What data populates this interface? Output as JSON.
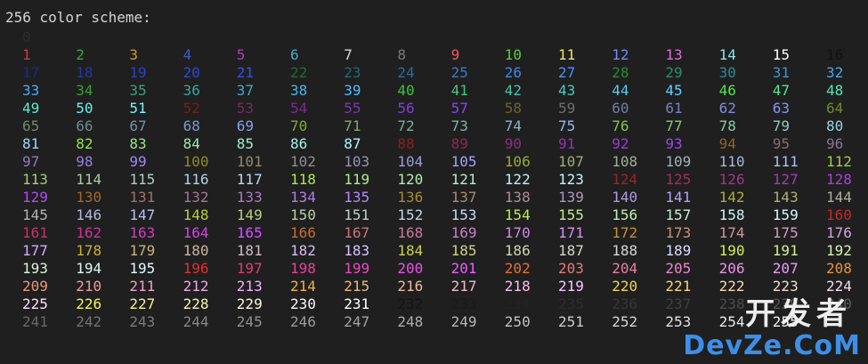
{
  "header": {
    "text": "256 color scheme:"
  },
  "rows": [
    {
      "cells": [
        {
          "n": "0",
          "c": "#2e2e2e"
        }
      ]
    },
    {
      "cells": [
        {
          "n": "1",
          "c": "#d13d3d"
        },
        {
          "n": "2",
          "c": "#3aa63a"
        },
        {
          "n": "3",
          "c": "#c89f2a"
        },
        {
          "n": "4",
          "c": "#3d5cc8"
        },
        {
          "n": "5",
          "c": "#a63fb8"
        },
        {
          "n": "6",
          "c": "#4aa8c8"
        },
        {
          "n": "7",
          "c": "#d8d8d8"
        },
        {
          "n": "8",
          "c": "#7a7a7a"
        },
        {
          "n": "9",
          "c": "#ee5c5c"
        },
        {
          "n": "10",
          "c": "#5ccc3c"
        },
        {
          "n": "11",
          "c": "#f0e06a"
        },
        {
          "n": "12",
          "c": "#6e8cf0"
        },
        {
          "n": "13",
          "c": "#e06ae0"
        },
        {
          "n": "14",
          "c": "#8ee6e6"
        },
        {
          "n": "15",
          "c": "#ffffff"
        },
        {
          "n": "16",
          "c": "#111111"
        }
      ]
    },
    {
      "cells": [
        {
          "n": "17",
          "c": "#1a2a8a"
        },
        {
          "n": "18",
          "c": "#2236a6"
        },
        {
          "n": "19",
          "c": "#2a42c4"
        },
        {
          "n": "20",
          "c": "#2e48dc"
        },
        {
          "n": "21",
          "c": "#3050f0"
        },
        {
          "n": "22",
          "c": "#1e6e2a"
        },
        {
          "n": "23",
          "c": "#1e6a70"
        },
        {
          "n": "24",
          "c": "#2e6a9a"
        },
        {
          "n": "25",
          "c": "#3a7ac8"
        },
        {
          "n": "26",
          "c": "#3e86e8"
        },
        {
          "n": "27",
          "c": "#4a90ff"
        },
        {
          "n": "28",
          "c": "#2a8a30"
        },
        {
          "n": "29",
          "c": "#2e8a6e"
        },
        {
          "n": "30",
          "c": "#2e8a9a"
        },
        {
          "n": "31",
          "c": "#3a9ac6"
        },
        {
          "n": "32",
          "c": "#4aa6ee"
        }
      ]
    },
    {
      "cells": [
        {
          "n": "33",
          "c": "#4aa8ff"
        },
        {
          "n": "34",
          "c": "#3a9e36"
        },
        {
          "n": "35",
          "c": "#3aa07a"
        },
        {
          "n": "36",
          "c": "#3aa29e"
        },
        {
          "n": "37",
          "c": "#44aac8"
        },
        {
          "n": "38",
          "c": "#4cb2ec"
        },
        {
          "n": "39",
          "c": "#52baff"
        },
        {
          "n": "40",
          "c": "#40c040"
        },
        {
          "n": "41",
          "c": "#48c482"
        },
        {
          "n": "42",
          "c": "#48c4a8"
        },
        {
          "n": "43",
          "c": "#4ec8c8"
        },
        {
          "n": "44",
          "c": "#56ccee"
        },
        {
          "n": "45",
          "c": "#5cd2ff"
        },
        {
          "n": "46",
          "c": "#4ee44e"
        },
        {
          "n": "47",
          "c": "#5ae48e"
        },
        {
          "n": "48",
          "c": "#5ae6b4"
        }
      ]
    },
    {
      "cells": [
        {
          "n": "49",
          "c": "#5ee8d4"
        },
        {
          "n": "50",
          "c": "#68eef2"
        },
        {
          "n": "51",
          "c": "#72f4ff"
        },
        {
          "n": "52",
          "c": "#7a1c1c"
        },
        {
          "n": "53",
          "c": "#7a2a5e"
        },
        {
          "n": "54",
          "c": "#7a2a8e"
        },
        {
          "n": "55",
          "c": "#7e34b4"
        },
        {
          "n": "56",
          "c": "#823ed8"
        },
        {
          "n": "57",
          "c": "#8844f4"
        },
        {
          "n": "58",
          "c": "#6e6424"
        },
        {
          "n": "59",
          "c": "#6e6e6e"
        },
        {
          "n": "60",
          "c": "#707ea0"
        },
        {
          "n": "61",
          "c": "#7682c0"
        },
        {
          "n": "62",
          "c": "#7c8ce0"
        },
        {
          "n": "63",
          "c": "#8494ff"
        },
        {
          "n": "64",
          "c": "#6e8a2a"
        }
      ]
    },
    {
      "cells": [
        {
          "n": "65",
          "c": "#6e8a6a"
        },
        {
          "n": "66",
          "c": "#6e8a8a"
        },
        {
          "n": "67",
          "c": "#7490ac"
        },
        {
          "n": "68",
          "c": "#7c98cc"
        },
        {
          "n": "69",
          "c": "#82a0ee"
        },
        {
          "n": "70",
          "c": "#7eaa34"
        },
        {
          "n": "71",
          "c": "#7eaa6e"
        },
        {
          "n": "72",
          "c": "#7eaa92"
        },
        {
          "n": "73",
          "c": "#84aeae"
        },
        {
          "n": "74",
          "c": "#8ab4d0"
        },
        {
          "n": "75",
          "c": "#90baf0"
        },
        {
          "n": "76",
          "c": "#84c840"
        },
        {
          "n": "77",
          "c": "#88c878"
        },
        {
          "n": "78",
          "c": "#8ccaa0"
        },
        {
          "n": "79",
          "c": "#90ccc0"
        },
        {
          "n": "80",
          "c": "#96d2e4"
        }
      ]
    },
    {
      "cells": [
        {
          "n": "81",
          "c": "#9cd8ff"
        },
        {
          "n": "82",
          "c": "#8ee84c"
        },
        {
          "n": "83",
          "c": "#94ea86"
        },
        {
          "n": "84",
          "c": "#98eaaa"
        },
        {
          "n": "85",
          "c": "#9eeccc"
        },
        {
          "n": "86",
          "c": "#a4f0ec"
        },
        {
          "n": "87",
          "c": "#acf6ff"
        },
        {
          "n": "88",
          "c": "#8a2020"
        },
        {
          "n": "89",
          "c": "#8a2a56"
        },
        {
          "n": "90",
          "c": "#8c2e86"
        },
        {
          "n": "91",
          "c": "#9034ac"
        },
        {
          "n": "92",
          "c": "#963cd0"
        },
        {
          "n": "93",
          "c": "#9c44f0"
        },
        {
          "n": "94",
          "c": "#8a6628"
        },
        {
          "n": "95",
          "c": "#8a6e6e"
        },
        {
          "n": "96",
          "c": "#8c7296"
        }
      ]
    },
    {
      "cells": [
        {
          "n": "97",
          "c": "#9078bc"
        },
        {
          "n": "98",
          "c": "#9680de"
        },
        {
          "n": "99",
          "c": "#9c88ff"
        },
        {
          "n": "100",
          "c": "#8e8a2c"
        },
        {
          "n": "101",
          "c": "#8e8a6e"
        },
        {
          "n": "102",
          "c": "#8e8e8e"
        },
        {
          "n": "103",
          "c": "#9296b6"
        },
        {
          "n": "104",
          "c": "#989cda"
        },
        {
          "n": "105",
          "c": "#9ea4fa"
        },
        {
          "n": "106",
          "c": "#98ac38"
        },
        {
          "n": "107",
          "c": "#9aae72"
        },
        {
          "n": "108",
          "c": "#9cae96"
        },
        {
          "n": "109",
          "c": "#a0b2b8"
        },
        {
          "n": "110",
          "c": "#a6b8da"
        },
        {
          "n": "111",
          "c": "#acbefa"
        },
        {
          "n": "112",
          "c": "#a2cc44"
        }
      ]
    },
    {
      "cells": [
        {
          "n": "113",
          "c": "#a6cc7e"
        },
        {
          "n": "114",
          "c": "#a8cca2"
        },
        {
          "n": "115",
          "c": "#accec4"
        },
        {
          "n": "116",
          "c": "#b0d2e6"
        },
        {
          "n": "117",
          "c": "#b6d8ff"
        },
        {
          "n": "118",
          "c": "#aaea50"
        },
        {
          "n": "119",
          "c": "#aeec8a"
        },
        {
          "n": "120",
          "c": "#b2ecae"
        },
        {
          "n": "121",
          "c": "#b6eed0"
        },
        {
          "n": "122",
          "c": "#baf2f0"
        },
        {
          "n": "123",
          "c": "#c0f6ff"
        },
        {
          "n": "124",
          "c": "#9e2424"
        },
        {
          "n": "125",
          "c": "#a02e5e"
        },
        {
          "n": "126",
          "c": "#a2348c"
        },
        {
          "n": "127",
          "c": "#a63ab4"
        },
        {
          "n": "128",
          "c": "#aa42d8"
        }
      ]
    },
    {
      "cells": [
        {
          "n": "129",
          "c": "#b04af8"
        },
        {
          "n": "130",
          "c": "#a0682c"
        },
        {
          "n": "131",
          "c": "#a27070"
        },
        {
          "n": "132",
          "c": "#a47498"
        },
        {
          "n": "133",
          "c": "#a87ac0"
        },
        {
          "n": "134",
          "c": "#ac82e2"
        },
        {
          "n": "135",
          "c": "#b28aff"
        },
        {
          "n": "136",
          "c": "#a48a34"
        },
        {
          "n": "137",
          "c": "#a68e72"
        },
        {
          "n": "138",
          "c": "#a89096"
        },
        {
          "n": "139",
          "c": "#ac96bc"
        },
        {
          "n": "140",
          "c": "#b09cde"
        },
        {
          "n": "141",
          "c": "#b6a2fc"
        },
        {
          "n": "142",
          "c": "#acac3c"
        },
        {
          "n": "143",
          "c": "#aeae76"
        },
        {
          "n": "144",
          "c": "#b0b09a"
        }
      ]
    },
    {
      "cells": [
        {
          "n": "145",
          "c": "#b2b2b2"
        },
        {
          "n": "146",
          "c": "#b6b8dc"
        },
        {
          "n": "147",
          "c": "#bcbeff"
        },
        {
          "n": "148",
          "c": "#b6ce48"
        },
        {
          "n": "149",
          "c": "#b8ce82"
        },
        {
          "n": "150",
          "c": "#bacea6"
        },
        {
          "n": "151",
          "c": "#bed0c8"
        },
        {
          "n": "152",
          "c": "#c2d4ea"
        },
        {
          "n": "153",
          "c": "#c8daff"
        },
        {
          "n": "154",
          "c": "#bcec54"
        },
        {
          "n": "155",
          "c": "#c0ec8e"
        },
        {
          "n": "156",
          "c": "#c2eeb2"
        },
        {
          "n": "157",
          "c": "#c6f0d4"
        },
        {
          "n": "158",
          "c": "#caf4f4"
        },
        {
          "n": "159",
          "c": "#d0f8ff"
        },
        {
          "n": "160",
          "c": "#c42828"
        }
      ]
    },
    {
      "cells": [
        {
          "n": "161",
          "c": "#c6326a"
        },
        {
          "n": "162",
          "c": "#c83894"
        },
        {
          "n": "163",
          "c": "#ca40bc"
        },
        {
          "n": "164",
          "c": "#ce48de"
        },
        {
          "n": "165",
          "c": "#d252ff"
        },
        {
          "n": "166",
          "c": "#c66c30"
        },
        {
          "n": "167",
          "c": "#c87474"
        },
        {
          "n": "168",
          "c": "#ca789c"
        },
        {
          "n": "169",
          "c": "#cc80c4"
        },
        {
          "n": "170",
          "c": "#d088e6"
        },
        {
          "n": "171",
          "c": "#d490ff"
        },
        {
          "n": "172",
          "c": "#c88e38"
        },
        {
          "n": "173",
          "c": "#ca9276"
        },
        {
          "n": "174",
          "c": "#cc969c"
        },
        {
          "n": "175",
          "c": "#ce9cc2"
        },
        {
          "n": "176",
          "c": "#d2a2e4"
        }
      ]
    },
    {
      "cells": [
        {
          "n": "177",
          "c": "#d6aaff"
        },
        {
          "n": "178",
          "c": "#cab040"
        },
        {
          "n": "179",
          "c": "#ccb27c"
        },
        {
          "n": "180",
          "c": "#ceb4a0"
        },
        {
          "n": "181",
          "c": "#d0b8c4"
        },
        {
          "n": "182",
          "c": "#d4bce6"
        },
        {
          "n": "183",
          "c": "#d8c2ff"
        },
        {
          "n": "184",
          "c": "#ccd04c"
        },
        {
          "n": "185",
          "c": "#ced286"
        },
        {
          "n": "186",
          "c": "#d0d4aa"
        },
        {
          "n": "187",
          "c": "#d2d6cc"
        },
        {
          "n": "188",
          "c": "#d6d6d6"
        },
        {
          "n": "189",
          "c": "#dadcff"
        },
        {
          "n": "190",
          "c": "#d0ee58"
        },
        {
          "n": "191",
          "c": "#d4f092"
        },
        {
          "n": "192",
          "c": "#d6f2b6"
        }
      ]
    },
    {
      "cells": [
        {
          "n": "193",
          "c": "#d8f4d8"
        },
        {
          "n": "194",
          "c": "#dcf6f6"
        },
        {
          "n": "195",
          "c": "#e2faff"
        },
        {
          "n": "196",
          "c": "#e62e2e"
        },
        {
          "n": "197",
          "c": "#e63870"
        },
        {
          "n": "198",
          "c": "#e8409a"
        },
        {
          "n": "199",
          "c": "#ea48c2"
        },
        {
          "n": "200",
          "c": "#ec52e4"
        },
        {
          "n": "201",
          "c": "#f05cff"
        },
        {
          "n": "202",
          "c": "#e67034"
        },
        {
          "n": "203",
          "c": "#e87878"
        },
        {
          "n": "204",
          "c": "#ea7ea0"
        },
        {
          "n": "205",
          "c": "#ec86c8"
        },
        {
          "n": "206",
          "c": "#ee90ea"
        },
        {
          "n": "207",
          "c": "#f298ff"
        },
        {
          "n": "208",
          "c": "#e8943c"
        }
      ]
    },
    {
      "cells": [
        {
          "n": "209",
          "c": "#ea987a"
        },
        {
          "n": "210",
          "c": "#ec9ca0"
        },
        {
          "n": "211",
          "c": "#eea2c6"
        },
        {
          "n": "212",
          "c": "#f0a8e8"
        },
        {
          "n": "213",
          "c": "#f4b0ff"
        },
        {
          "n": "214",
          "c": "#eab444"
        },
        {
          "n": "215",
          "c": "#ecb67e"
        },
        {
          "n": "216",
          "c": "#eeb8a2"
        },
        {
          "n": "217",
          "c": "#f0bcc6"
        },
        {
          "n": "218",
          "c": "#f2c2e8"
        },
        {
          "n": "219",
          "c": "#f6c8ff"
        },
        {
          "n": "220",
          "c": "#f0d450"
        },
        {
          "n": "221",
          "c": "#f0d688"
        },
        {
          "n": "222",
          "c": "#f2d8ac"
        },
        {
          "n": "223",
          "c": "#f4dace"
        },
        {
          "n": "224",
          "c": "#f6dcf0"
        }
      ]
    },
    {
      "cells": [
        {
          "n": "225",
          "c": "#fae2ff"
        },
        {
          "n": "226",
          "c": "#f6f25a"
        },
        {
          "n": "227",
          "c": "#f6f294"
        },
        {
          "n": "228",
          "c": "#f8f4b8"
        },
        {
          "n": "229",
          "c": "#faf6da"
        },
        {
          "n": "230",
          "c": "#fcf8f8"
        },
        {
          "n": "231",
          "c": "#ffffff"
        },
        {
          "n": "232",
          "c": "#141414"
        },
        {
          "n": "233",
          "c": "#1a1a1a"
        },
        {
          "n": "234",
          "c": "#232323"
        },
        {
          "n": "235",
          "c": "#2c2c2c"
        },
        {
          "n": "236",
          "c": "#363636"
        },
        {
          "n": "237",
          "c": "#404040"
        },
        {
          "n": "238",
          "c": "#4a4a4a"
        },
        {
          "n": "239",
          "c": "#545454"
        },
        {
          "n": "240",
          "c": "#5e5e5e"
        }
      ]
    },
    {
      "cells": [
        {
          "n": "241",
          "c": "#686868"
        },
        {
          "n": "242",
          "c": "#727272"
        },
        {
          "n": "243",
          "c": "#7c7c7c"
        },
        {
          "n": "244",
          "c": "#868686"
        },
        {
          "n": "245",
          "c": "#909090"
        },
        {
          "n": "246",
          "c": "#9a9a9a"
        },
        {
          "n": "247",
          "c": "#a4a4a4"
        },
        {
          "n": "248",
          "c": "#aeaeae"
        },
        {
          "n": "249",
          "c": "#b8b8b8"
        },
        {
          "n": "250",
          "c": "#c2c2c2"
        },
        {
          "n": "251",
          "c": "#cccccc"
        },
        {
          "n": "252",
          "c": "#d6d6d6"
        },
        {
          "n": "253",
          "c": "#e0e0e0"
        },
        {
          "n": "254",
          "c": "#eaeaea"
        },
        {
          "n": "255",
          "c": "#f4f4f4"
        }
      ]
    }
  ],
  "watermark": {
    "top": "开发者",
    "bottom": "DevZe.CoM"
  }
}
